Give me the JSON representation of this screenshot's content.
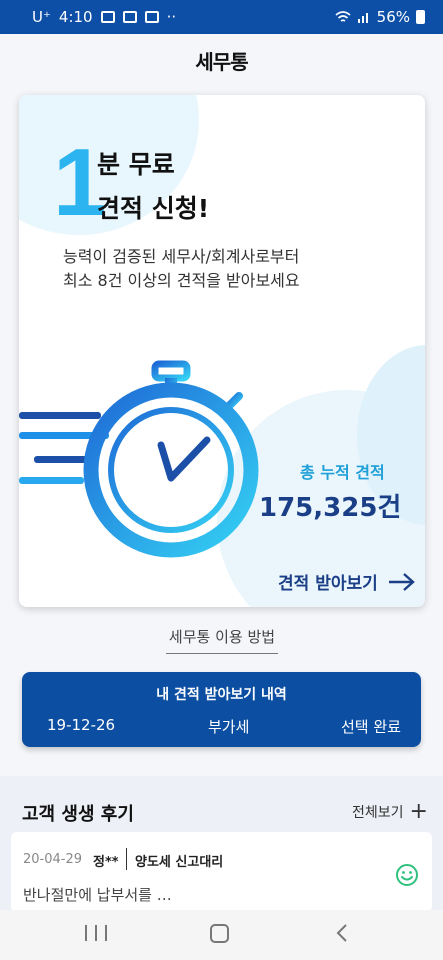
{
  "status": {
    "carrier": "U⁺",
    "time": "4:10",
    "dots": "··",
    "battery": "56%"
  },
  "app": {
    "logo": "세무통"
  },
  "hero": {
    "big_number": "1",
    "line1": "분 무료",
    "line2": "견적 신청!",
    "desc1": "능력이 검증된 세무사/회계사로부터",
    "desc2": "최소 8건 이상의 견적을 받아보세요",
    "total_label": "총 누적 견적",
    "total_value": "175,325건",
    "cta": "견적 받아보기"
  },
  "howto": "세무통 이용 방법",
  "history": {
    "title": "내 견적 받아보기 내역",
    "date": "19-12-26",
    "type": "부가세",
    "status": "선택 완료"
  },
  "reviews": {
    "title": "고객 생생 후기",
    "see_all": "전체보기",
    "items": [
      {
        "date": "20-04-29",
        "name": "정**",
        "category": "양도세 신고대리",
        "text": "반나절만에 납부서를 …"
      }
    ]
  },
  "colors": {
    "status_bar": "#0d4fa6",
    "accent": "#2bb4ef",
    "navy": "#1b3f86",
    "history_card": "#0b4ea2",
    "smile": "#2ec27e"
  }
}
